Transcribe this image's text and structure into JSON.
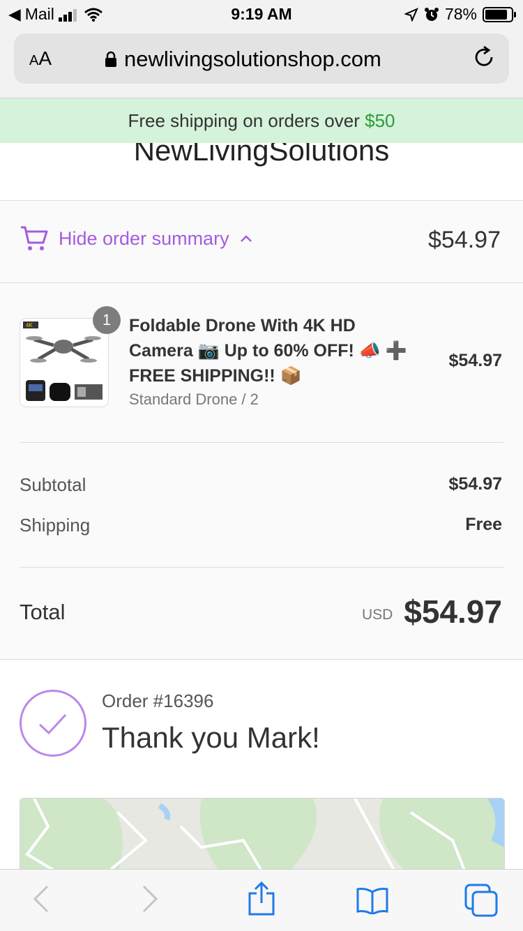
{
  "status_bar": {
    "back_app": "Mail",
    "time": "9:19 AM",
    "battery": "78%",
    "battery_level": 0.78
  },
  "browser": {
    "text_size_label_small": "A",
    "text_size_label_large": "A",
    "url": "newlivingsolutionshop.com"
  },
  "announcement": {
    "text": "Free shipping on orders over",
    "amount": "$50"
  },
  "store": {
    "name": "NewLivingSolutions"
  },
  "order_summary": {
    "toggle_label": "Hide order summary",
    "toggle_total": "$54.97",
    "item": {
      "quantity": "1",
      "title": "Foldable Drone With 4K HD Camera 📷 Up to 60% OFF! 📣 ➕ FREE SHIPPING!! 📦",
      "variant": "Standard Drone / 2",
      "price": "$54.97",
      "thumb_badge": "4K"
    },
    "subtotal_label": "Subtotal",
    "subtotal_value": "$54.97",
    "shipping_label": "Shipping",
    "shipping_value": "Free",
    "total_label": "Total",
    "total_currency": "USD",
    "total_value": "$54.97"
  },
  "confirmation": {
    "order_number": "Order #16396",
    "thank_you": "Thank you Mark!"
  },
  "colors": {
    "accent": "#a35ce0",
    "announcement_bg": "#d4f3da",
    "announcement_amount": "#2f9a3a",
    "ios_blue": "#1f7aea"
  }
}
